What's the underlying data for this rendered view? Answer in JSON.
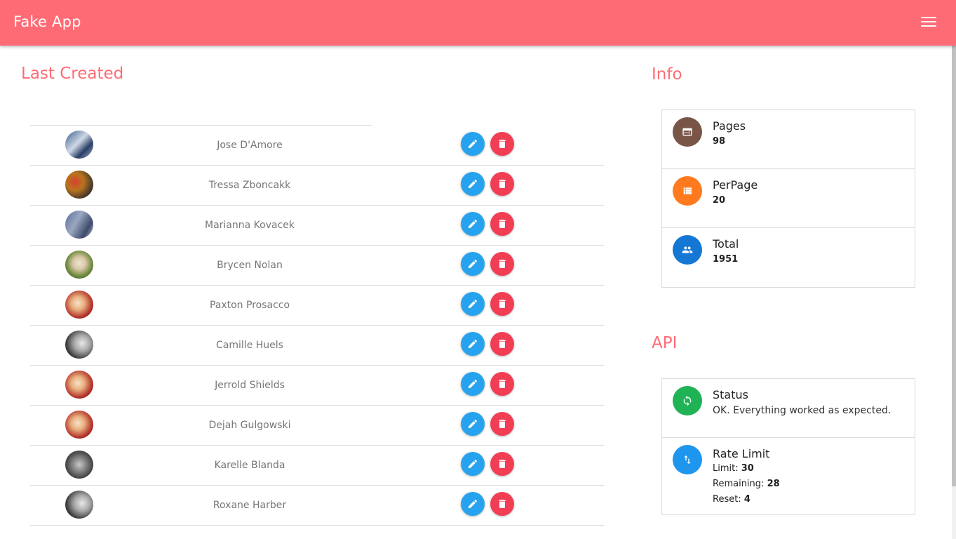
{
  "app": {
    "title": "Fake App"
  },
  "sections": {
    "last_created": "Last Created",
    "info": "Info",
    "api": "API"
  },
  "users": [
    {
      "name": "Jose D'Amore",
      "avatar": "photo-street"
    },
    {
      "name": "Tressa Zboncakk",
      "avatar": "photo-market"
    },
    {
      "name": "Marianna Kovacek",
      "avatar": "photo-crowd"
    },
    {
      "name": "Brycen Nolan",
      "avatar": "photo-girl-green"
    },
    {
      "name": "Paxton Prosacco",
      "avatar": "photo-girl-red"
    },
    {
      "name": "Camille Huels",
      "avatar": "photo-bw-face"
    },
    {
      "name": "Jerrold Shields",
      "avatar": "photo-girl-red"
    },
    {
      "name": "Dejah Gulgowski",
      "avatar": "photo-girl-red"
    },
    {
      "name": "Karelle Blanda",
      "avatar": "photo-bw-man"
    },
    {
      "name": "Roxane Harber",
      "avatar": "photo-bw-face"
    }
  ],
  "info": [
    {
      "title": "Pages",
      "value": "98",
      "icon": "web-icon",
      "color": "#795548"
    },
    {
      "title": "PerPage",
      "value": "20",
      "icon": "list-icon",
      "color": "#ff7a1f"
    },
    {
      "title": "Total",
      "value": "1951",
      "icon": "people-icon",
      "color": "#1377d3"
    }
  ],
  "api": {
    "status": {
      "title": "Status",
      "text": "OK. Everything worked as expected.",
      "icon": "sync-icon",
      "color": "#1fb355"
    },
    "rate_limit": {
      "title": "Rate Limit",
      "icon": "swap-vert-icon",
      "color": "#1e96ee",
      "limit_label": "Limit:",
      "limit": "30",
      "remaining_label": "Remaining:",
      "remaining": "28",
      "reset_label": "Reset:",
      "reset": "4"
    }
  },
  "colors": {
    "header": "#ff6b75",
    "accent": "#ff6b75",
    "edit": "#27a2ee",
    "delete": "#f23e55"
  }
}
